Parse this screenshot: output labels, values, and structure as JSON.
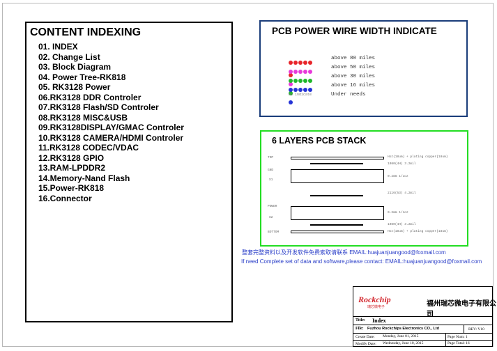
{
  "index": {
    "title": "CONTENT INDEXING",
    "items": [
      "01. INDEX",
      "02. Change List",
      "03. Block Diagram",
      "04. Power Tree-RK818",
      "05. RK3128 Power",
      "06.RK3128 DDR Controler",
      "07.RK3128 Flash/SD Controler",
      "08.RK3128 MISC&USB",
      "09.RK3128DISPLAY/GMAC Controler",
      "10.RK3128 CAMERA/HDMI Controler",
      "11.RK3128 CODEC/VDAC",
      "12.RK3128 GPIO",
      "13.RAM-LPDDR2",
      "14.Memory-Nand Flash",
      "15.Power-RK818",
      "16.Connector"
    ]
  },
  "power": {
    "title": "PCB POWER WIRE WIDTH INDICATE",
    "legend": [
      {
        "label": "above 80 miles",
        "color": "#e8252a"
      },
      {
        "label": "above 50 miles",
        "color": "#e83ad9"
      },
      {
        "label": "above 30 miles",
        "color": "#20b82a"
      },
      {
        "label": "above 16 miles",
        "color": "#2433d6"
      },
      {
        "label": "Under needs",
        "swatch_text": "No indicate"
      }
    ]
  },
  "stack": {
    "title": "6 LAYERS PCB STACK",
    "layers": {
      "top": "TOP",
      "gnd": "GND",
      "s1": "S1",
      "power": "POWER",
      "s2": "S2",
      "bottom": "BOTTOM"
    },
    "specs": {
      "top1": "Hoz(18um) + plating copper(18um)",
      "top2": "1080(4H)   3.2mil",
      "core1": "0.2mm   1/1oz",
      "prepreg": "2116(53)   4.2mil",
      "core2": "0.2mm   1/1oz",
      "bot2": "1080(4H)   3.2mil",
      "bot1": "Hoz(18um) + plating copper(18um)"
    }
  },
  "notes": {
    "cn": "整套完整资料以及开发软件免费索取请联系 EMAIL:huajuanjuangood@foxmail.com",
    "en": "If need Complete set of data and software,please contact: EMAIL:huajuanjuangood@foxmail.com"
  },
  "titleblock": {
    "logo": "Rockchip",
    "logo_sub": "瑞芯微电子",
    "company_cn": "福州瑞芯微电子有限公司",
    "title_label": "Title:",
    "title_value": "Index",
    "file_label": "File:",
    "file_value": "Fuzhou Rockchips Electronics CO., Ltd",
    "rev": "REV: V10",
    "create_label": "Create Date:",
    "create_value": "Monday, June 01, 2015",
    "modify_label": "Modify Date:",
    "modify_value": "Wednesday, June 10, 2015",
    "page_num": "Page Num: 1",
    "page_total": "Page Total: 16"
  }
}
